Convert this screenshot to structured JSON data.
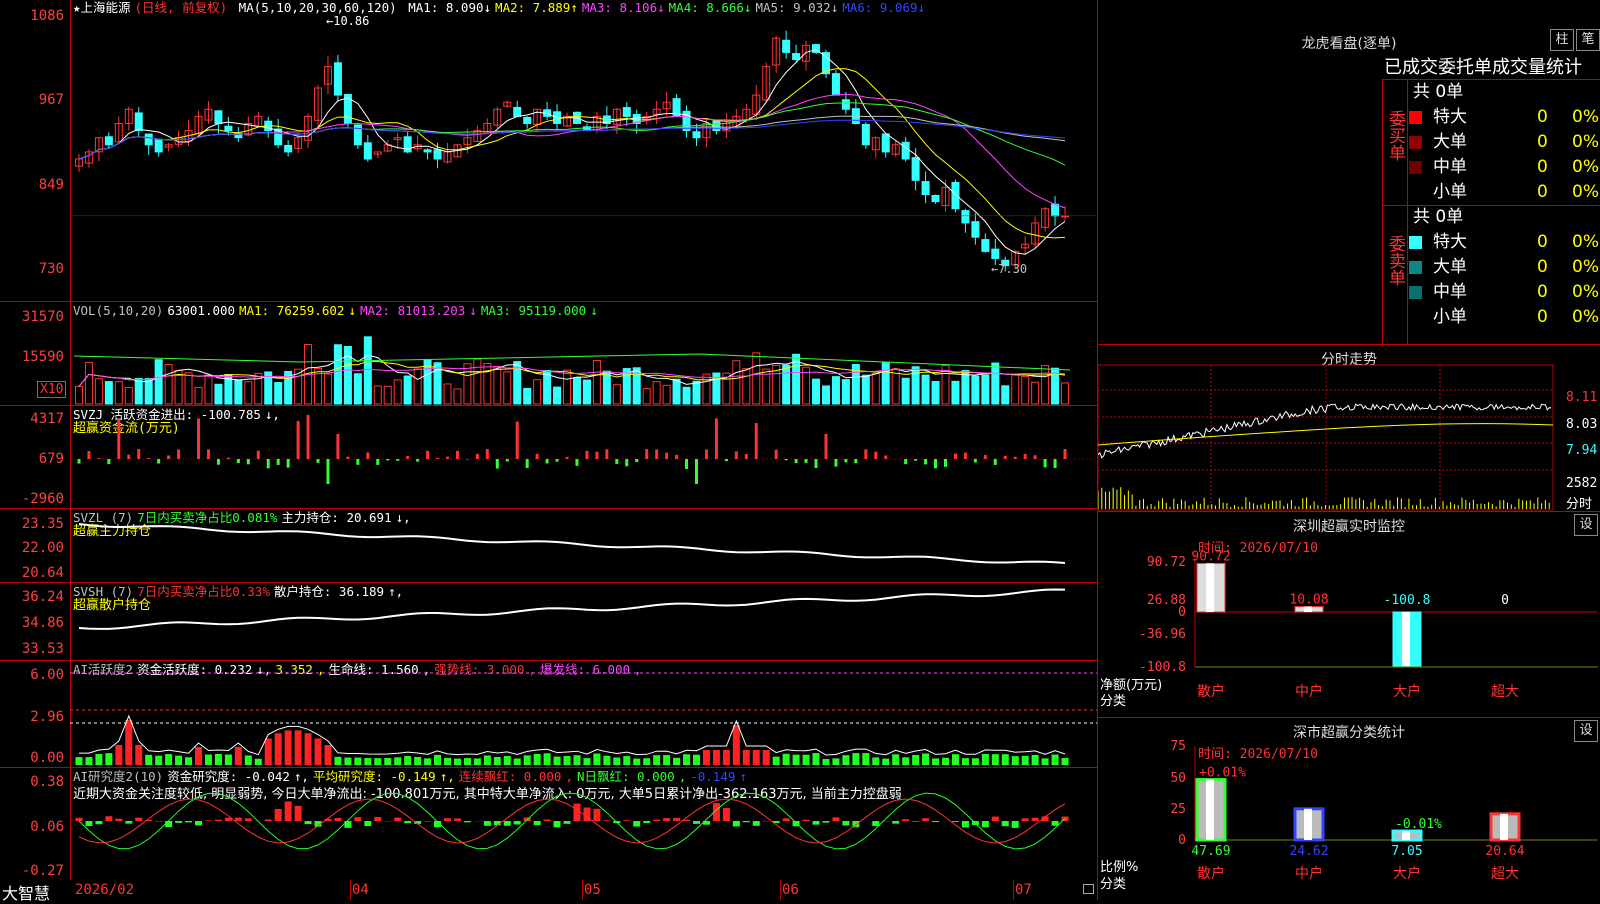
{
  "kline": {
    "stock": "★上海能源",
    "period": "(日线, 前复权)",
    "ma_header": "MA(5,10,20,30,60,120)",
    "ma": [
      {
        "label": "MA1: 8.090",
        "arrow": "↓",
        "color": "#ffffff"
      },
      {
        "label": "MA2: 7.889",
        "arrow": "↑",
        "color": "#ffff00"
      },
      {
        "label": "MA3: 8.106",
        "arrow": "↓",
        "color": "#ff44ff"
      },
      {
        "label": "MA4: 8.666",
        "arrow": "↓",
        "color": "#33ff33"
      },
      {
        "label": "MA5: 9.032",
        "arrow": "↓",
        "color": "#c0c0c0"
      },
      {
        "label": "MA6: 9.069",
        "arrow": "↓",
        "color": "#3344ff"
      }
    ],
    "y_ticks": [
      "1086",
      "967",
      "849",
      "730"
    ],
    "high_note": "←10.86",
    "low_note": "←7.30"
  },
  "vol": {
    "header": "VOL(5,10,20)",
    "value": "63001.000",
    "ma1": "MA1: 76259.602",
    "ma2": "MA2: 81013.203",
    "ma3": "MA3: 95119.000",
    "y_ticks": [
      "31570",
      "15590"
    ],
    "unit": "X10"
  },
  "svzj": {
    "line1": "SVZJ  活跃资金进出: -100.785",
    "line2": "超赢资金流(万元)",
    "y_ticks": [
      "4317",
      "679",
      "-2960"
    ]
  },
  "svzl": {
    "name": "SVZL (7)",
    "p1": "7日内买卖净占比0.081%",
    "p2": "主力持仓: 20.691",
    "line2": "超赢主力持仓",
    "y_ticks": [
      "23.35",
      "22.00",
      "20.64"
    ]
  },
  "svsh": {
    "name": "SVSH (7)",
    "p1": "7日内买卖净占比0.33%",
    "p2": "散户持仓: 36.189",
    "line2": "超赢散户持仓",
    "y_ticks": [
      "36.24",
      "34.86",
      "33.53"
    ]
  },
  "ai1": {
    "name": "AI活跃度2",
    "p1": "资金活跃度: 0.232",
    "p2": "3.352",
    "p3": "生命线: 1.560",
    "p4": "强势线: 3.000",
    "p5": "爆发线: 6.000",
    "y_ticks": [
      "6.00",
      "2.96",
      "0.00"
    ]
  },
  "ai2": {
    "name": "AI研究度2(10)",
    "p1": "资金研究度: -0.042",
    "p2": "平均研究度: -0.149",
    "p3": "连续飘红: 0.000",
    "p4": "N日飘红: 0.000",
    "p5": "-0.149",
    "note": "近期大资金关注度较低, 明显弱势, 今日大单净流出: -100.801万元, 其中特大单净流入: 0万元, 大单5日累计净出-362.163万元, 当前主力控盘弱",
    "y_ticks": [
      "0.38",
      "0.06",
      "-0.27"
    ]
  },
  "timeline": {
    "app": "大智慧",
    "labels": [
      "2026/02",
      "04",
      "05",
      "06",
      "07"
    ]
  },
  "longhu": {
    "title": "龙虎看盘(逐单)",
    "btn1": "柱",
    "btn2": "笔",
    "subtitle": "已成交委托单成交量统计",
    "buy_side": "委买单",
    "sell_side": "委卖单",
    "buy_total": "共 0单",
    "sell_total": "共 0单",
    "buy_rows": [
      {
        "label": "特大",
        "count": "0",
        "pct": "0%",
        "color": "#ff0000"
      },
      {
        "label": "大单",
        "count": "0",
        "pct": "0%",
        "color": "#900000"
      },
      {
        "label": "中单",
        "count": "0",
        "pct": "0%",
        "color": "#700000"
      },
      {
        "label": "小单",
        "count": "0",
        "pct": "0%",
        "color": ""
      }
    ],
    "sell_rows": [
      {
        "label": "特大",
        "count": "0",
        "pct": "0%",
        "color": "#33ffff"
      },
      {
        "label": "大单",
        "count": "0",
        "pct": "0%",
        "color": "#0a8888"
      },
      {
        "label": "中单",
        "count": "0",
        "pct": "0%",
        "color": "#0a7070"
      },
      {
        "label": "小单",
        "count": "0",
        "pct": "0%",
        "color": ""
      }
    ]
  },
  "intraday": {
    "title": "分时走势",
    "y_ticks": [
      "8.11",
      "8.03",
      "7.94"
    ],
    "vol_tick": "2582",
    "vol_label": "分时"
  },
  "monitor": {
    "title": "深圳超赢实时监控",
    "btn": "设",
    "time": "时间: 2026/07/10",
    "y_ticks": [
      "90.72",
      "26.88",
      "0",
      "-36.96",
      "-100.8"
    ],
    "ylabel1": "净额(万元)",
    "ylabel2": "分类",
    "bars": [
      {
        "cat": "散户",
        "value": "90.72",
        "num": 90.72
      },
      {
        "cat": "中户",
        "value": "10.08",
        "num": 10.08
      },
      {
        "cat": "大户",
        "value": "-100.8",
        "num": -100.8
      },
      {
        "cat": "超大",
        "value": "0",
        "num": 0
      }
    ]
  },
  "classify": {
    "title": "深市超赢分类统计",
    "btn": "设",
    "time": "时间: 2026/07/10",
    "y_ticks": [
      "75",
      "50",
      "25",
      "0"
    ],
    "ylabel1": "比例%",
    "ylabel2": "分类",
    "bars": [
      {
        "cat": "散户",
        "value": "47.69",
        "num": 47.69,
        "delta": "+0.01%",
        "color": "#33ff33"
      },
      {
        "cat": "中户",
        "value": "24.62",
        "num": 24.62,
        "delta": "",
        "color": "#3344ff"
      },
      {
        "cat": "大户",
        "value": "7.05",
        "num": 7.05,
        "delta": "-0.01%",
        "color": "#33ffff"
      },
      {
        "cat": "超大",
        "value": "20.64",
        "num": 20.64,
        "delta": "",
        "color": "#ff3333"
      }
    ]
  }
}
